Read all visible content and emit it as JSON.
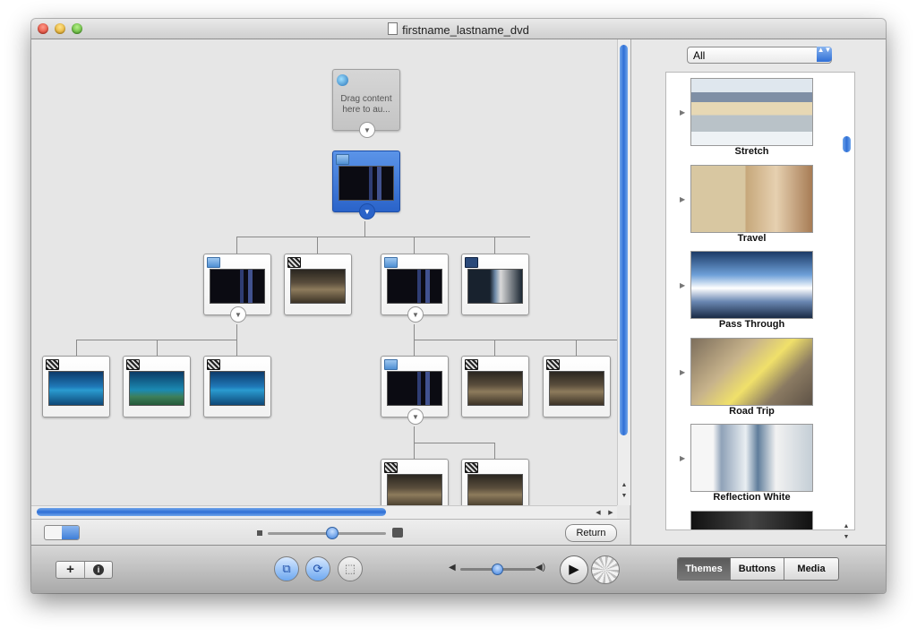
{
  "window": {
    "title": "firstname_lastname_dvd"
  },
  "map": {
    "drop_zone_text": "Drag content here to au..."
  },
  "left_footer": {
    "return_label": "Return"
  },
  "themes_panel": {
    "filter_value": "All",
    "filter_arrow": "▲▼",
    "themes": [
      {
        "name": "Stretch"
      },
      {
        "name": "Travel"
      },
      {
        "name": "Pass Through"
      },
      {
        "name": "Road Trip"
      },
      {
        "name": "Reflection White"
      },
      {
        "name": ""
      }
    ]
  },
  "toolbar": {
    "add_label": "+",
    "info_label": "i",
    "mode_buttons": [
      "Themes",
      "Buttons",
      "Media"
    ],
    "active_mode": "Themes"
  },
  "icons": {
    "play": "▶",
    "vol_low": "◀",
    "vol_high": "◀)",
    "tree_expand": "▼",
    "scroll_up": "▲",
    "scroll_down": "▼",
    "scroll_left": "◀",
    "scroll_right": "▶"
  },
  "colors": {
    "accent": "#2f6fd6",
    "selected_node": "#2a63c9"
  }
}
